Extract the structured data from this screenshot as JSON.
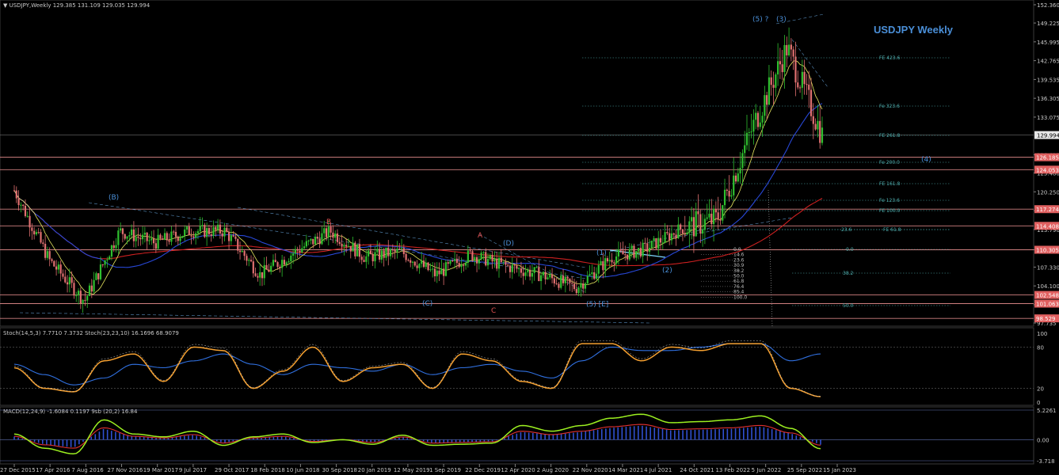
{
  "header": {
    "symbol_tf": "USDJPY,Weekly",
    "ohlc": "129.385 131.109 129.035 129.994",
    "chart_title": "USDJPY Weekly"
  },
  "indicators": {
    "stoch_label": "Stoch(14,5,3) 7.7710 7.3732  Stoch(23,23,10) 16.1696 68.9079",
    "macd_label": "MACD(12,24,9) -1.6084 0.1197  9sb (20,2) 16.84"
  },
  "colors": {
    "background": "#000000",
    "up_candle": "#2fbf2f",
    "down_candle": "#e07070",
    "ma_red": "#cc2020",
    "ma_blue": "#2848d8",
    "ma_yellow": "#e8e860",
    "fib_teal": "#4fb0b0",
    "wave_blue": "#4a8fd8",
    "level_line": "#d08080",
    "stoch_orange": "#f5a030",
    "stoch_blue": "#3070e0",
    "macd_lime": "#9cf020",
    "macd_hist": "#3050d0",
    "macd_signal": "#e03030"
  },
  "chart_data": [
    {
      "type": "candlestick",
      "title": "USDJPY Weekly",
      "ylim": [
        97.735,
        152.36
      ],
      "y_ticks": [
        "152.360",
        "149.225",
        "145.995",
        "142.765",
        "139.535",
        "136.305",
        "133.075",
        "129.994",
        "126.615",
        "123.480",
        "120.250",
        "117.020",
        "113.790",
        "110.305",
        "107.330",
        "104.100",
        "100.870",
        "97.735"
      ],
      "x_ticks": [
        "27 Dec 2015",
        "17 Apr 2016",
        "7 Aug 2016",
        "27 Nov 2016",
        "19 Mar 2017",
        "9 Jul 2017",
        "29 Oct 2017",
        "18 Feb 2018",
        "10 Jun 2018",
        "30 Sep 2018",
        "20 Jan 2019",
        "12 May 2019",
        "1 Sep 2019",
        "22 Dec 2019",
        "12 Apr 2020",
        "2 Aug 2020",
        "22 Nov 2020",
        "14 Mar 2021",
        "4 Jul 2021",
        "24 Oct 2021",
        "13 Feb 2022",
        "5 Jun 2022",
        "25 Sep 2022",
        "15 Jan 2023"
      ],
      "current_price": "129.994",
      "horizontal_levels": [
        "126.185",
        "124.053",
        "117.274",
        "114.408",
        "110.305",
        "102.548",
        "101.063",
        "98.529"
      ],
      "fib_labels": [
        "FE 423.6",
        "Fe 323.6",
        "FE 261.8",
        "Fe 200.0",
        "FE 161.8",
        "Fe 123.6",
        "FE 100.0",
        "FE 61.8",
        "0.0",
        "23.6",
        "38.2",
        "50.0"
      ],
      "retracement_stack": [
        "0.0",
        "14.6",
        "23.6",
        "30.9",
        "38.2",
        "50.0",
        "61.8",
        "76.4",
        "85.4",
        "100.0"
      ],
      "wave_labels": [
        "(B)",
        "B",
        "A",
        "(D)",
        "(C)",
        "C",
        "(1)",
        "(2)",
        "(5) ?",
        "(3)",
        "(4)",
        "(5) [E]",
        "A",
        "B"
      ],
      "price_path": [
        {
          "x": "27 Dec 2015",
          "y": 120.5
        },
        {
          "x": "17 Apr 2016",
          "y": 108.5
        },
        {
          "x": "7 Aug 2016",
          "y": 101.5
        },
        {
          "x": "27 Nov 2016",
          "y": 113.5
        },
        {
          "x": "19 Mar 2017",
          "y": 111.5
        },
        {
          "x": "9 Jul 2017",
          "y": 113.5
        },
        {
          "x": "29 Oct 2017",
          "y": 113.5
        },
        {
          "x": "18 Feb 2018",
          "y": 106.0
        },
        {
          "x": "10 Jun 2018",
          "y": 110.0
        },
        {
          "x": "30 Sep 2018",
          "y": 113.5
        },
        {
          "x": "20 Jan 2019",
          "y": 109.0
        },
        {
          "x": "12 May 2019",
          "y": 110.0
        },
        {
          "x": "1 Sep 2019",
          "y": 106.0
        },
        {
          "x": "22 Dec 2019",
          "y": 109.5
        },
        {
          "x": "12 Apr 2020",
          "y": 107.5
        },
        {
          "x": "2 Aug 2020",
          "y": 106.0
        },
        {
          "x": "22 Nov 2020",
          "y": 103.8
        },
        {
          "x": "14 Mar 2021",
          "y": 109.0
        },
        {
          "x": "4 Jul 2021",
          "y": 110.5
        },
        {
          "x": "24 Oct 2021",
          "y": 114.0
        },
        {
          "x": "13 Feb 2022",
          "y": 115.5
        },
        {
          "x": "5 Jun 2022",
          "y": 131.0
        },
        {
          "x": "25 Sep 2022",
          "y": 145.0
        },
        {
          "x": "15 Jan 2023",
          "y": 129.99
        }
      ]
    },
    {
      "type": "line",
      "title": "Stoch(14,5,3) 7.7710 7.3732  Stoch(23,23,10) 16.1696 68.9079",
      "ylim": [
        0,
        100
      ],
      "y_ticks": [
        "100",
        "80",
        "20",
        "0"
      ],
      "series": [
        {
          "values": [
            50,
            20,
            15,
            60,
            70,
            30,
            80,
            75,
            20,
            45,
            80,
            30,
            50,
            55,
            20,
            70,
            60,
            30,
            20,
            85,
            85,
            60,
            80,
            75,
            85,
            85,
            20,
            8
          ]
        },
        {
          "values": [
            55,
            40,
            25,
            35,
            55,
            50,
            60,
            70,
            55,
            40,
            55,
            50,
            45,
            55,
            40,
            50,
            55,
            45,
            35,
            60,
            80,
            75,
            75,
            80,
            85,
            85,
            60,
            70
          ]
        }
      ]
    },
    {
      "type": "line",
      "title": "MACD(12,24,9) -1.6084 0.1197  9sb (20,2) 16.84",
      "ylim": [
        -3.718,
        5.226
      ],
      "y_ticks": [
        "5.2261",
        "0.00",
        "-3.718"
      ],
      "series": [
        {
          "values": [
            1.0,
            -1.5,
            -2.5,
            3.5,
            1.0,
            0.5,
            1.5,
            -1.0,
            0.5,
            1.0,
            -0.5,
            0.0,
            -0.8,
            0.8,
            -1.0,
            -0.8,
            -0.6,
            2.5,
            1.5,
            2.5,
            3.8,
            4.5,
            3.0,
            3.2,
            3.5,
            4.2,
            2.0,
            -1.6
          ]
        }
      ]
    }
  ]
}
